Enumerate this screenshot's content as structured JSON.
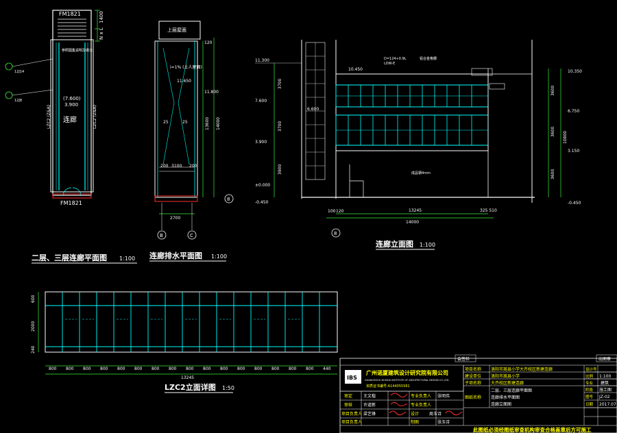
{
  "titles": {
    "plan": "二层、三层连廊平面图",
    "plan_scale": "1:100",
    "drain": "连廊排水平面图",
    "drain_scale": "1:100",
    "elev": "连廊立面图",
    "elev_scale": "1:100",
    "lzc2": "LZC2立面详图",
    "lzc2_scale": "1:50"
  },
  "plan": {
    "fm_top": "FM1821",
    "fm_bottom": "FM1821",
    "room": "连廊",
    "level1": "(7.600)",
    "level2": "3.900",
    "side_left": "LZC2 (Z&A)",
    "side_right": "LZC2 (Z&A)",
    "note_top": "参照图集说明及做法",
    "dim_a": "1400",
    "dim_b": "N x L",
    "tag1": "12J14",
    "tag2": "12J8"
  },
  "drain": {
    "box": "上层屋面",
    "note": "i=1% (上人屋面)",
    "level": "11.650",
    "d1": "25",
    "d2": "25",
    "d3": "200",
    "d4": "3100",
    "d5": "200",
    "width": "2700",
    "v1": "120",
    "v2": "13600",
    "v3": "14000",
    "v4": "11.800",
    "axis_b": "B",
    "axis_c": "C",
    "axis_8": "8"
  },
  "elev": {
    "l1": "11.300",
    "l2": "7.600",
    "l3": "3.900",
    "l4": "±0.000",
    "l5": "-0.450",
    "h1": "3700",
    "h2": "3700",
    "h3": "3900",
    "r1": "10.350",
    "r2": "6.750",
    "r3": "3.150",
    "r4": "-0.450",
    "rh1": "3600",
    "rh2": "3600",
    "rh3": "3600",
    "rh4": "10800",
    "mid": "6.600",
    "top": "10.450",
    "note1": "D=124+0.9L",
    "note2": "LDW-E",
    "note3": "铝合金格栅",
    "note4": "成品钢4mm",
    "w_total": "14000",
    "w_main": "13245",
    "w_left": "120",
    "w_right": "325 510",
    "w_100": "100",
    "axis": "8"
  },
  "lzc2": {
    "h_top": "600",
    "h_mid": "2000",
    "h_bot": "240",
    "dims": [
      "800",
      "800",
      "800",
      "800",
      "800",
      "800",
      "800",
      "800",
      "800",
      "800",
      "800",
      "800",
      "800",
      "800",
      "800",
      "800",
      "440"
    ],
    "total": "13245",
    "left": "800"
  },
  "tb": {
    "company": "广州诺厦建筑设计研究院有限公司",
    "company_en": "GUANGZHOU NUOXIA INSTITUTE OF ARCHITECTURAL DESIGN CO.,LTD.",
    "license": "资质证书编号:A144055561",
    "sign_label": "会签栏",
    "seal_label": "出图章",
    "proj_label": "项目名称",
    "proj_value": "洛阳市嵩县小学大齐校区新建连廊",
    "build_label": "建设单位",
    "build_value": "洛阳市嵩县小学",
    "sub_label": "子项名称",
    "sub_value": "大齐校区新建连廊",
    "drawing_label": "图纸名称",
    "drawing_value1": "二层、三层连廊平面图",
    "drawing_value2": "连廊排水平面图",
    "drawing_value3": "连廊立面图",
    "stage_label": "设计号",
    "scale_label": "比例",
    "scale_value": "1:100",
    "major_label": "专业",
    "major_value": "建筑",
    "phase_label": "阶段",
    "phase_value": "施工图",
    "num_label": "图号",
    "num_value": "JZ-02",
    "date_label": "日期",
    "date_value": "2017.07",
    "r1a": "审定",
    "r1b": "王文楷",
    "r1c": "专业负责人",
    "r1d": "张明伟",
    "r2a": "审核",
    "r2b": "许道新",
    "r2c": "专业负责人",
    "r3a": "项目负责人",
    "r3b": "梁艺锋",
    "r3c": "设计",
    "r3d": "周玉诗",
    "r4a": "项目负责人",
    "r4c": "制图",
    "r4d": "张玉诗",
    "footer": "此图纸必须经图纸审查机构审查合格盖章后方可施工"
  }
}
